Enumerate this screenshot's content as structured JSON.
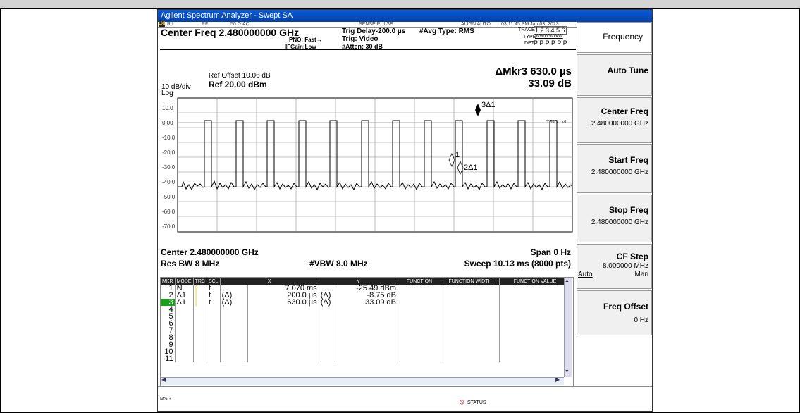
{
  "window": {
    "title": "Agilent Spectrum Analyzer - Swept SA"
  },
  "statusbar": {
    "rl": "R L",
    "rf": "RF",
    "impedance": "50 Ω  AC",
    "sense": "SENSE:PULSE",
    "align": "ALIGN AUTO",
    "datetime": "03:11:45 PM Jan 03, 2023"
  },
  "header": {
    "center_freq": "Center Freq 2.480000000 GHz",
    "pno": "PNO: Fast",
    "ifgain": "IFGain:Low",
    "trig_delay": "Trig Delay-200.0 µs",
    "trig": "Trig: Video",
    "atten": "#Atten: 30 dB",
    "avg_type": "#Avg Type: RMS",
    "trace_label": "TRACE",
    "trace_nums": "1 2 3 4 5 6",
    "type_label": "TYPE",
    "type_val": "WWWWWW",
    "det_label": "DET",
    "det_val": "P P P P P P"
  },
  "plot": {
    "ref_offset": "Ref Offset 10.06 dB",
    "ref": "Ref 20.00 dBm",
    "scale": "10 dB/div",
    "log": "Log",
    "marker_readout": "ΔMkr3 630.0 µs",
    "marker_value": "33.09 dB",
    "y_ticks": [
      "10.0",
      "0.00",
      "-10.0",
      "-20.0",
      "-30.0",
      "-40.0",
      "-50.0",
      "-60.0",
      "-70.0"
    ],
    "trig_lvl": "TRIG LVL",
    "marker_labels": [
      "3Δ1",
      "1",
      "2Δ1"
    ],
    "center": "Center 2.480000000 GHz",
    "span": "Span 0 Hz",
    "res_bw": "Res BW 8 MHz",
    "vbw": "#VBW 8.0 MHz",
    "sweep": "Sweep  10.13 ms (8000 pts)"
  },
  "softkeys": {
    "menu_title": "Frequency",
    "auto_tune": "Auto Tune",
    "center_freq": {
      "label": "Center Freq",
      "value": "2.480000000 GHz"
    },
    "start_freq": {
      "label": "Start Freq",
      "value": "2.480000000 GHz"
    },
    "stop_freq": {
      "label": "Stop Freq",
      "value": "2.480000000 GHz"
    },
    "cf_step": {
      "label": "CF Step",
      "value": "8.000000 MHz",
      "auto": "Auto",
      "man": "Man"
    },
    "freq_offset": {
      "label": "Freq Offset",
      "value": "0 Hz"
    }
  },
  "marker_table": {
    "headers": [
      "MKR",
      "MODE",
      "TRC",
      "SCL",
      "X",
      "Y",
      "FUNCTION",
      "FUNCTION WIDTH",
      "FUNCTION VALUE"
    ],
    "rows": [
      {
        "mkr": "1",
        "mode": "N",
        "scl": "t",
        "xd": "",
        "x": "7.070 ms",
        "yd": "",
        "y": "-25.49 dBm"
      },
      {
        "mkr": "2",
        "mode": "Δ1",
        "scl": "t",
        "xd": "(Δ)",
        "x": "200.0 µs",
        "yd": "(Δ)",
        "y": "-8.75 dB"
      },
      {
        "mkr": "3",
        "mode": "Δ1",
        "scl": "t",
        "xd": "(Δ)",
        "x": "630.0 µs",
        "yd": "(Δ)",
        "y": "33.09 dB"
      },
      {
        "mkr": "4"
      },
      {
        "mkr": "5"
      },
      {
        "mkr": "6"
      },
      {
        "mkr": "7"
      },
      {
        "mkr": "8"
      },
      {
        "mkr": "9"
      },
      {
        "mkr": "10"
      },
      {
        "mkr": "11"
      }
    ]
  },
  "bottom": {
    "msg": "MSG",
    "status": "STATUS"
  }
}
